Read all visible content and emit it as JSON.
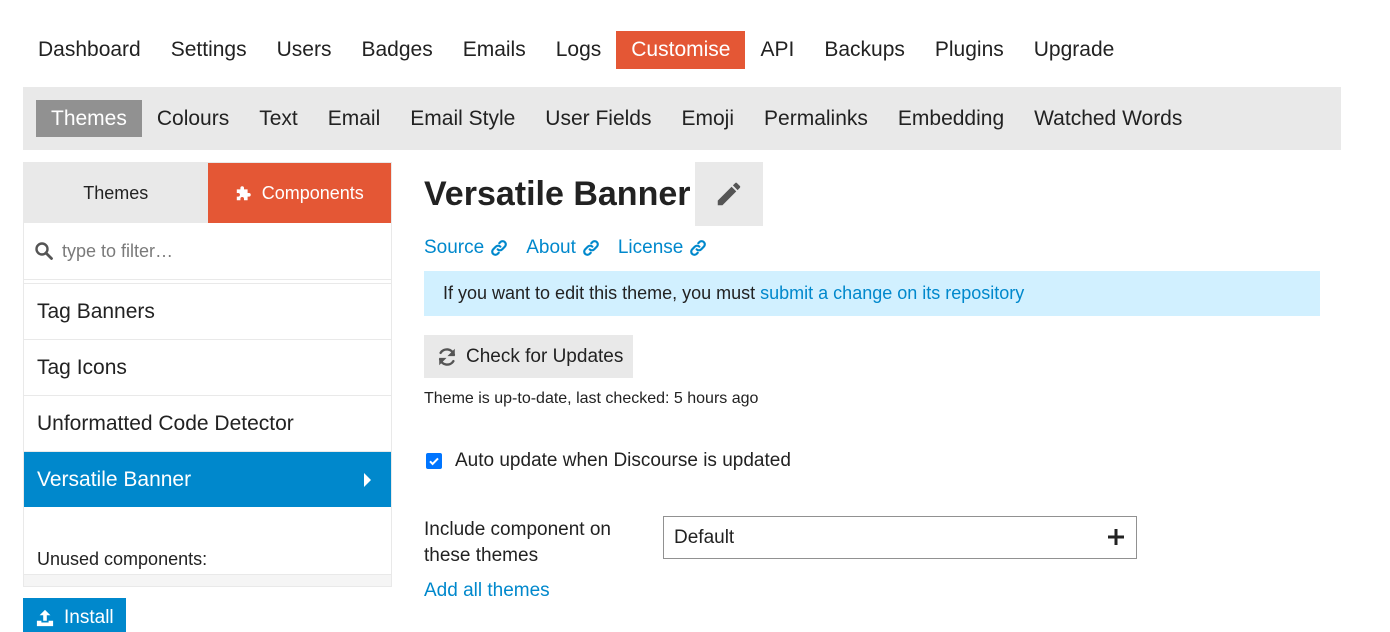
{
  "top_nav": {
    "items": [
      "Dashboard",
      "Settings",
      "Users",
      "Badges",
      "Emails",
      "Logs",
      "Customise",
      "API",
      "Backups",
      "Plugins",
      "Upgrade"
    ],
    "active": "Customise"
  },
  "sub_nav": {
    "items": [
      "Themes",
      "Colours",
      "Text",
      "Email",
      "Email Style",
      "User Fields",
      "Emoji",
      "Permalinks",
      "Embedding",
      "Watched Words"
    ],
    "active": "Themes"
  },
  "sidebar": {
    "tabs": {
      "themes": "Themes",
      "components": "Components"
    },
    "filter_placeholder": "type to filter…",
    "items": [
      "Tag Banners",
      "Tag Icons",
      "Unformatted Code Detector",
      "Versatile Banner"
    ],
    "selected": "Versatile Banner",
    "unused_label": "Unused components:",
    "install_label": "Install"
  },
  "main": {
    "title": "Versatile Banner",
    "links": [
      "Source",
      "About",
      "License"
    ],
    "notice_text": "If you want to edit this theme, you must",
    "notice_link": "submit a change on its repository",
    "check_updates_label": "Check for Updates",
    "status_text": "Theme is up-to-date, last checked: 5 hours ago",
    "auto_update_label": "Auto update when Discourse is updated",
    "auto_update_checked": true,
    "include_label": "Include component on these themes",
    "include_value": "Default",
    "add_all_label": "Add all themes"
  },
  "colors": {
    "accent_orange": "#e45735",
    "selected_blue": "#0088cc",
    "notice_bg": "#d1f0ff",
    "gray_bg": "#e9e9e9"
  }
}
